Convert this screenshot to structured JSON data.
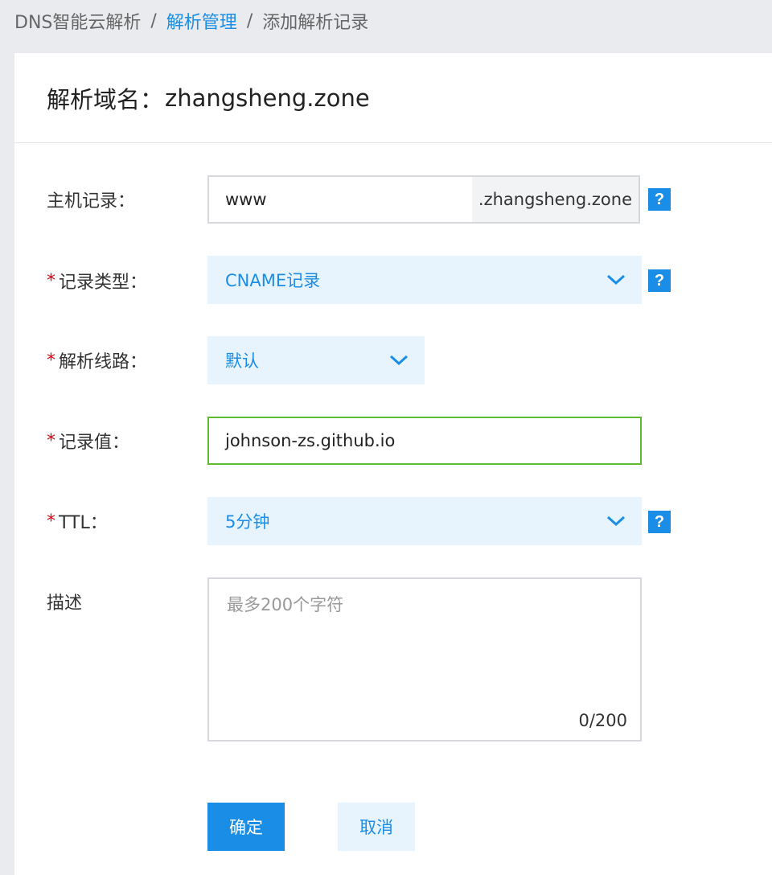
{
  "breadcrumb": {
    "items": [
      "DNS智能云解析",
      "解析管理",
      "添加解析记录"
    ],
    "separator": "/"
  },
  "header": {
    "label": "解析域名：",
    "domain": "zhangsheng.zone"
  },
  "form": {
    "host": {
      "label": "主机记录：",
      "value": "www",
      "suffix": ".zhangsheng.zone",
      "help": "?"
    },
    "type": {
      "label": "记录类型：",
      "value": "CNAME记录",
      "help": "?"
    },
    "line": {
      "label": "解析线路：",
      "value": "默认"
    },
    "record_value": {
      "label": "记录值：",
      "value": "johnson-zs.github.io"
    },
    "ttl": {
      "label": "TTL：",
      "value": "5分钟",
      "help": "?"
    },
    "description": {
      "label": "描述",
      "placeholder": "最多200个字符",
      "counter": "0/200"
    },
    "required_mark": "*"
  },
  "actions": {
    "confirm": "确定",
    "cancel": "取消"
  },
  "colors": {
    "accent": "#1a8de6",
    "required": "#e60012",
    "valid_border": "#5cbb35"
  }
}
